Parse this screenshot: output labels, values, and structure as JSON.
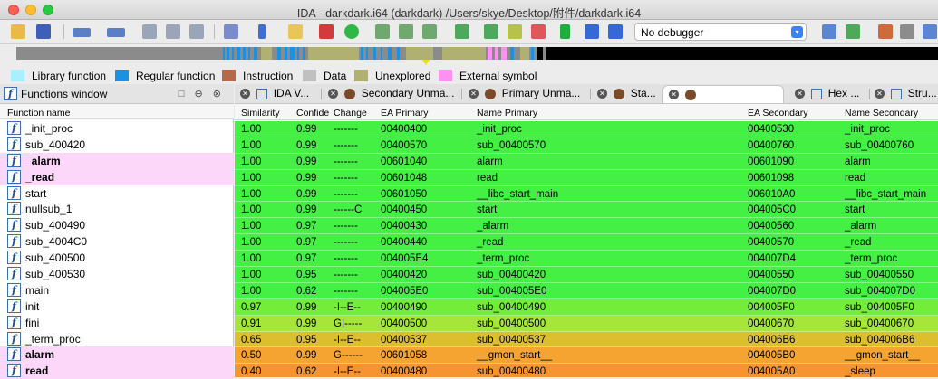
{
  "window": {
    "title": "IDA - darkdark.i64 (darkdark) /Users/skye/Desktop/附件/darkdark.i64"
  },
  "toolbar": {
    "debugger_value": "No debugger"
  },
  "legend": {
    "items": [
      {
        "label": "Library function",
        "color": "#a8f0ff"
      },
      {
        "label": "Regular function",
        "color": "#1e90e0"
      },
      {
        "label": "Instruction",
        "color": "#b5684a"
      },
      {
        "label": "Data",
        "color": "#c0c0c0"
      },
      {
        "label": "Unexplored",
        "color": "#b0b070"
      },
      {
        "label": "External symbol",
        "color": "#ff90f0"
      }
    ]
  },
  "functions_window": {
    "title": "Functions window",
    "column_header": "Function name",
    "items": [
      {
        "name": "_init_proc",
        "highlight": false
      },
      {
        "name": "sub_400420",
        "highlight": false
      },
      {
        "name": "_alarm",
        "highlight": true
      },
      {
        "name": "_read",
        "highlight": true
      },
      {
        "name": "start",
        "highlight": false
      },
      {
        "name": "nullsub_1",
        "highlight": false
      },
      {
        "name": "sub_400490",
        "highlight": false
      },
      {
        "name": "sub_4004C0",
        "highlight": false
      },
      {
        "name": "sub_400500",
        "highlight": false
      },
      {
        "name": "sub_400530",
        "highlight": false
      },
      {
        "name": "main",
        "highlight": false
      },
      {
        "name": "init",
        "highlight": false
      },
      {
        "name": "fini",
        "highlight": false
      },
      {
        "name": "_term_proc",
        "highlight": false
      },
      {
        "name": "alarm",
        "highlight": true
      },
      {
        "name": "read",
        "highlight": true
      }
    ]
  },
  "tabs": [
    {
      "label": "IDA V..."
    },
    {
      "label": "Secondary Unma..."
    },
    {
      "label": "Primary Unma..."
    },
    {
      "label": "Sta..."
    },
    {
      "label": ""
    },
    {
      "label": "Hex ..."
    },
    {
      "label": "Stru..."
    }
  ],
  "table": {
    "headers": [
      "Similarity",
      "Confide",
      "Change",
      "EA Primary",
      "Name Primary",
      "EA Secondary",
      "Name Secondary"
    ],
    "rows": [
      {
        "cells": [
          "1.00",
          "0.99",
          "-------",
          "00400400",
          "_init_proc",
          "00400530",
          "_init_proc"
        ],
        "color": "#43f043"
      },
      {
        "cells": [
          "1.00",
          "0.99",
          "-------",
          "00400570",
          "sub_00400570",
          "00400760",
          "sub_00400760"
        ],
        "color": "#43f043"
      },
      {
        "cells": [
          "1.00",
          "0.99",
          "-------",
          "00601040",
          "alarm",
          "00601090",
          "alarm"
        ],
        "color": "#43f043"
      },
      {
        "cells": [
          "1.00",
          "0.99",
          "-------",
          "00601048",
          "read",
          "00601098",
          "read"
        ],
        "color": "#43f043"
      },
      {
        "cells": [
          "1.00",
          "0.99",
          "-------",
          "00601050",
          "__libc_start_main",
          "006010A0",
          "__libc_start_main"
        ],
        "color": "#43f043"
      },
      {
        "cells": [
          "1.00",
          "0.99",
          "------C",
          "00400450",
          "start",
          "004005C0",
          "start"
        ],
        "color": "#43f043"
      },
      {
        "cells": [
          "1.00",
          "0.97",
          "-------",
          "00400430",
          "_alarm",
          "00400560",
          "_alarm"
        ],
        "color": "#43f043"
      },
      {
        "cells": [
          "1.00",
          "0.97",
          "-------",
          "00400440",
          "_read",
          "00400570",
          "_read"
        ],
        "color": "#43f043"
      },
      {
        "cells": [
          "1.00",
          "0.97",
          "-------",
          "004005E4",
          "_term_proc",
          "004007D4",
          "_term_proc"
        ],
        "color": "#43f043"
      },
      {
        "cells": [
          "1.00",
          "0.95",
          "-------",
          "00400420",
          "sub_00400420",
          "00400550",
          "sub_00400550"
        ],
        "color": "#43f043"
      },
      {
        "cells": [
          "1.00",
          "0.62",
          "-------",
          "004005E0",
          "sub_004005E0",
          "004007D0",
          "sub_004007D0"
        ],
        "color": "#43f043"
      },
      {
        "cells": [
          "0.97",
          "0.99",
          "-I--E--",
          "00400490",
          "sub_00400490",
          "004005F0",
          "sub_004005F0"
        ],
        "color": "#74ec3a"
      },
      {
        "cells": [
          "0.91",
          "0.99",
          "GI-----",
          "00400500",
          "sub_00400500",
          "00400670",
          "sub_00400670"
        ],
        "color": "#a6e63a"
      },
      {
        "cells": [
          "0.65",
          "0.95",
          "-I--E--",
          "00400537",
          "sub_00400537",
          "004006B6",
          "sub_004006B6"
        ],
        "color": "#dcbf2e"
      },
      {
        "cells": [
          "0.50",
          "0.99",
          "G------",
          "00601058",
          "__gmon_start__",
          "004005B0",
          "__gmon_start__"
        ],
        "color": "#f5a431"
      },
      {
        "cells": [
          "0.40",
          "0.62",
          "-I--E--",
          "00400480",
          "sub_00400480",
          "004005A0",
          "_sleep"
        ],
        "color": "#f89430"
      }
    ]
  }
}
